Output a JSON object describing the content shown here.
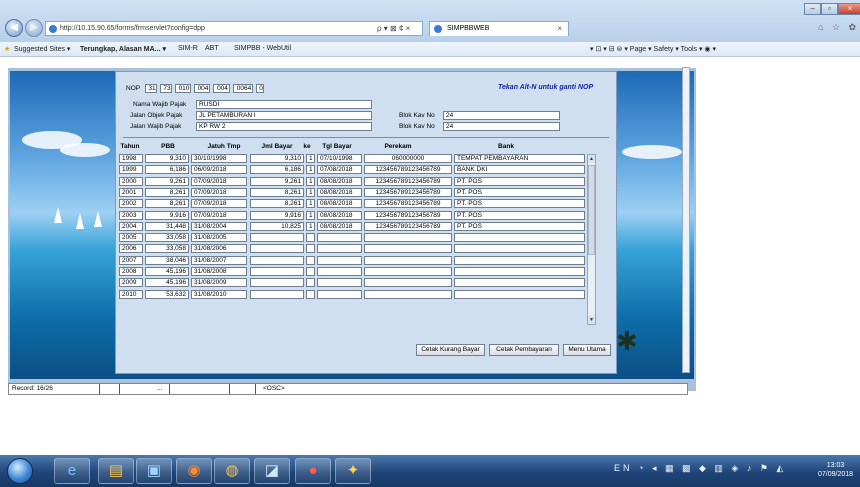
{
  "browser": {
    "url": "http://10.15.90.65/forms/frmservlet?config=dpp",
    "tab_title": "SIMPBBWEB",
    "tab_close": "×",
    "address_tools": "ρ ▾ ⊠ ¢ ×",
    "window_min": "–",
    "window_max": "▫",
    "window_close": "×",
    "right_icons": "⌂ ☆ ✿"
  },
  "favorites": {
    "suggested": "Suggested Sites ▾",
    "terungkap": "Terungkap, Alasan MA... ▾",
    "simr": "SIM-R",
    "abt": "ABT",
    "simpbb": "SIMPBB - WebUtil",
    "toolbar_right": "▾ ⊡ ▾ ⊟ ⊜ ▾ Page ▾  Safety ▾  Tools ▾  ◉ ▾"
  },
  "form": {
    "nop_label": "NOP",
    "nop": [
      "31",
      "73",
      "010",
      "004",
      "004",
      "0064",
      "0"
    ],
    "hint": "Tekan Alt-N untuk ganti NOP",
    "nama_label": "Nama Wajib Pajak",
    "nama_value": "RUSDI",
    "jalan_objek_label": "Jalan Objek Pajak",
    "jalan_objek_value": "JL PETAMBURAN I",
    "jalan_wajib_label": "Jalan Wajib Pajak",
    "jalan_wajib_value": "KP RW 2",
    "blok1_label": "Blok Kav No",
    "blok1_value": "24",
    "blok2_label": "Blok Kav No",
    "blok2_value": "24"
  },
  "table": {
    "headers": [
      "Tahun",
      "PBB",
      "Jatuh Tmp",
      "Jml Bayar",
      "ke",
      "Tgl Bayar",
      "Perekam",
      "Bank"
    ],
    "rows": [
      {
        "tahun": "1998",
        "pbb": "9,310",
        "jatuh": "30/10/1998",
        "jml": "9,310",
        "ke": "1",
        "tgl": "07/10/1998",
        "perekam": "060000000",
        "bank": "TEMPAT PEMBAYARAN"
      },
      {
        "tahun": "1999",
        "pbb": "6,186",
        "jatuh": "06/09/2018",
        "jml": "6,186",
        "ke": "1",
        "tgl": "07/08/2018",
        "perekam": "123456789123456789",
        "bank": "BANK DKI"
      },
      {
        "tahun": "2000",
        "pbb": "9,261",
        "jatuh": "07/09/2018",
        "jml": "9,261",
        "ke": "1",
        "tgl": "08/08/2018",
        "perekam": "123456789123456789",
        "bank": "PT. POS"
      },
      {
        "tahun": "2001",
        "pbb": "8,261",
        "jatuh": "07/09/2018",
        "jml": "8,261",
        "ke": "1",
        "tgl": "08/08/2018",
        "perekam": "123456789123456789",
        "bank": "PT. POS"
      },
      {
        "tahun": "2002",
        "pbb": "8,261",
        "jatuh": "07/09/2018",
        "jml": "8,261",
        "ke": "1",
        "tgl": "08/08/2018",
        "perekam": "123456789123456789",
        "bank": "PT. POS"
      },
      {
        "tahun": "2003",
        "pbb": "9,916",
        "jatuh": "07/09/2018",
        "jml": "9,916",
        "ke": "1",
        "tgl": "08/08/2018",
        "perekam": "123456789123456789",
        "bank": "PT. POS"
      },
      {
        "tahun": "2004",
        "pbb": "31,448",
        "jatuh": "31/08/2004",
        "jml": "10,825",
        "ke": "1",
        "tgl": "08/08/2018",
        "perekam": "123456789123456789",
        "bank": "PT. POS"
      },
      {
        "tahun": "2005",
        "pbb": "33,058",
        "jatuh": "31/08/2005",
        "jml": "",
        "ke": "",
        "tgl": "",
        "perekam": "",
        "bank": ""
      },
      {
        "tahun": "2006",
        "pbb": "33,058",
        "jatuh": "31/08/2006",
        "jml": "",
        "ke": "",
        "tgl": "",
        "perekam": "",
        "bank": ""
      },
      {
        "tahun": "2007",
        "pbb": "38,046",
        "jatuh": "31/08/2007",
        "jml": "",
        "ke": "",
        "tgl": "",
        "perekam": "",
        "bank": ""
      },
      {
        "tahun": "2008",
        "pbb": "45,196",
        "jatuh": "31/08/2008",
        "jml": "",
        "ke": "",
        "tgl": "",
        "perekam": "",
        "bank": ""
      },
      {
        "tahun": "2009",
        "pbb": "45,196",
        "jatuh": "31/08/2009",
        "jml": "",
        "ke": "",
        "tgl": "",
        "perekam": "",
        "bank": ""
      },
      {
        "tahun": "2010",
        "pbb": "53,632",
        "jatuh": "31/08/2010",
        "jml": "",
        "ke": "",
        "tgl": "",
        "perekam": "",
        "bank": ""
      }
    ]
  },
  "buttons": {
    "cetak_kurang": "Cetak Kurang Bayar",
    "cetak_pembayaran": "Cetak Pembayaran",
    "menu_utama": "Menu Utama"
  },
  "status": {
    "record": "Record: 16/26",
    "ellipsis": "...",
    "osc": "<OSC>"
  },
  "taskbar": {
    "lang": "EN",
    "time": "13:03",
    "date": "07/09/2018"
  }
}
